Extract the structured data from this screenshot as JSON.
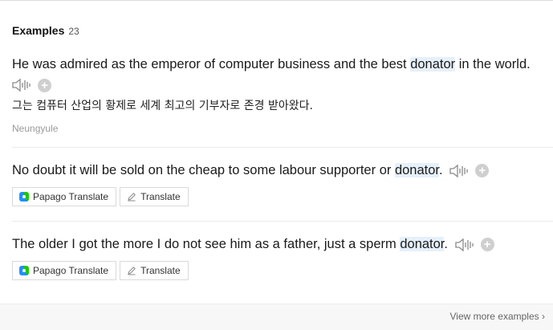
{
  "header": {
    "title": "Examples",
    "count": "23"
  },
  "examples": [
    {
      "pre": "He was admired as the emperor of computer business and the best ",
      "term": "donator",
      "post": " in the world.",
      "translation": "그는 컴퓨터 산업의 황제로 세계 최고의 기부자로 존경 받아왔다.",
      "source": "Neungyule"
    },
    {
      "pre": "No doubt it will be sold on the cheap to some labour supporter or ",
      "term": "donator",
      "post": "."
    },
    {
      "pre": "The older I got the more I do not see him as a father, just a sperm ",
      "term": "donator",
      "post": "."
    }
  ],
  "buttons": {
    "papago": "Papago Translate",
    "translate": "Translate"
  },
  "footer": {
    "more": "View more examples"
  },
  "colors": {
    "highlight": "#e6f0fb",
    "plus": "#cfcfcf",
    "papago_green": "#1ec800",
    "papago_blue": "#1e90ff"
  }
}
